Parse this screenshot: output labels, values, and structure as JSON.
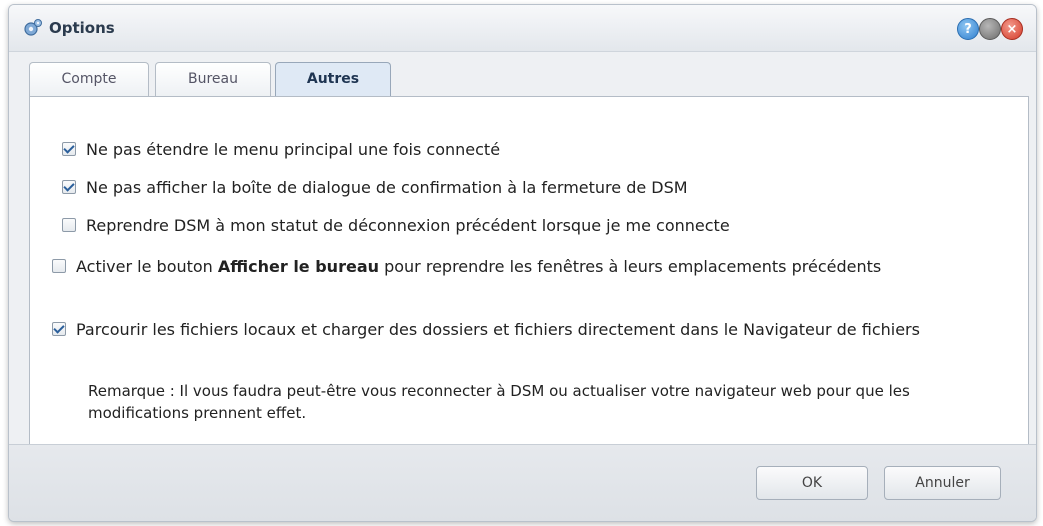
{
  "window": {
    "title": "Options",
    "icon": "options-gear-icon",
    "controls": {
      "help": "?",
      "minimize": "",
      "close": "×"
    }
  },
  "tabs": [
    {
      "label": "Compte",
      "active": false
    },
    {
      "label": "Bureau",
      "active": false
    },
    {
      "label": "Autres",
      "active": true
    }
  ],
  "options": [
    {
      "checked": true,
      "text": "Ne pas étendre le menu principal une fois connecté"
    },
    {
      "checked": true,
      "text": "Ne pas afficher la boîte de dialogue de confirmation à la fermeture de DSM"
    },
    {
      "checked": false,
      "text": "Reprendre DSM à mon statut de déconnexion précédent lorsque je me connecte"
    },
    {
      "checked": false,
      "text_before": "Activer le bouton ",
      "text_bold": "Afficher le bureau",
      "text_after": " pour reprendre les fenêtres à leurs emplacements précédents"
    },
    {
      "checked": true,
      "text": "Parcourir les fichiers locaux et charger des dossiers et fichiers directement dans le Navigateur de fichiers"
    }
  ],
  "note": "Remarque : Il vous faudra peut-être vous reconnecter à DSM ou actualiser votre navigateur web pour que les modifications prennent effet.",
  "buttons": {
    "ok": "OK",
    "cancel": "Annuler"
  }
}
